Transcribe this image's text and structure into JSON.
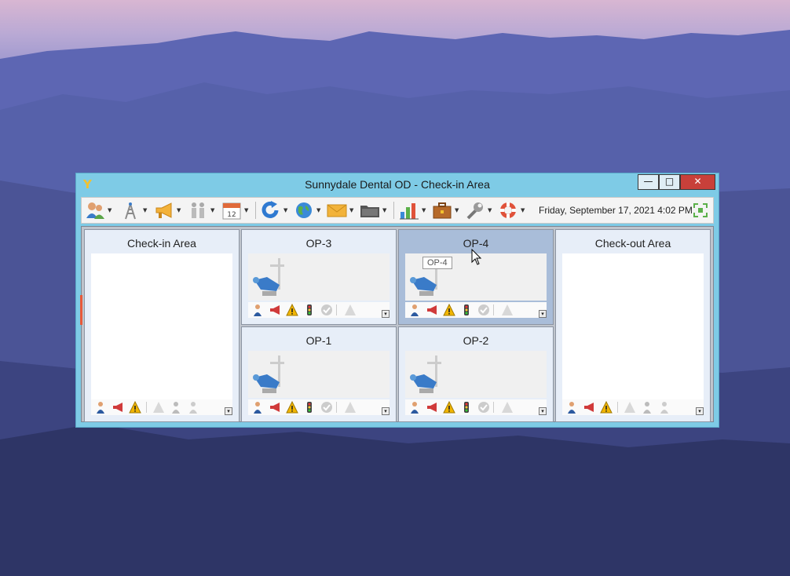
{
  "window": {
    "title": "Sunnydale Dental OD - Check-in Area",
    "controls": {
      "minimize": "—",
      "maximize": "□",
      "close": "✕"
    }
  },
  "toolbar": {
    "items": [
      "patients-icon",
      "radio-tower-icon",
      "megaphone-icon",
      "family-icon",
      "calendar-icon",
      "refresh-icon",
      "globe-icon",
      "mail-icon",
      "folder-icon",
      "chart-icon",
      "briefcase-icon",
      "wrench-icon",
      "lifebuoy-icon"
    ],
    "calendar_day": "12",
    "datetime": "Friday, September 17, 2021 4:02 PM"
  },
  "panels": {
    "checkin": {
      "title": "Check-in Area"
    },
    "op3": {
      "title": "OP-3"
    },
    "op4": {
      "title": "OP-4",
      "tooltip": "OP-4"
    },
    "op1": {
      "title": "OP-1"
    },
    "op2": {
      "title": "OP-2"
    },
    "checkout": {
      "title": "Check-out Area"
    }
  },
  "colors": {
    "accent_window": "#7ecbe6",
    "close_button": "#c8403a",
    "warning": "#f2b600"
  }
}
